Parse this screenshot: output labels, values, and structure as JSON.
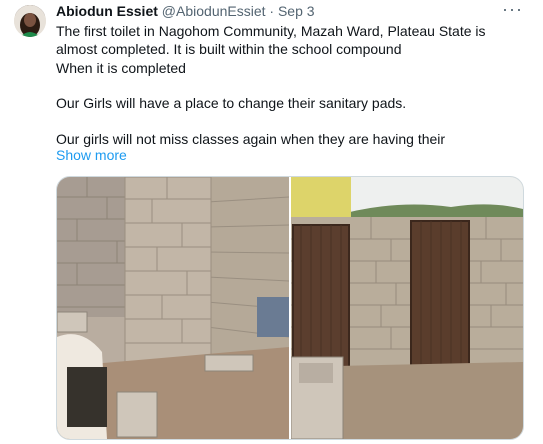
{
  "tweet": {
    "author_name": "Abiodun Essiet",
    "author_handle": "@AbiodunEssiet",
    "separator": "·",
    "date": "Sep 3",
    "lines": [
      "The first toilet in Nagohom Community, Mazah Ward,  Plateau State is",
      "almost completed. It is built within the school compound",
      "When it is completed",
      "",
      "Our Girls will have a place to change their sanitary pads.",
      "",
      "Our girls  will not miss classes again when they are having their"
    ],
    "show_more": "Show more",
    "more_icon": "more-options-icon",
    "media": [
      {
        "name": "photo-left",
        "description": "unfinished block wall interior"
      },
      {
        "name": "photo-right",
        "description": "block wall with two metal doors"
      }
    ]
  }
}
